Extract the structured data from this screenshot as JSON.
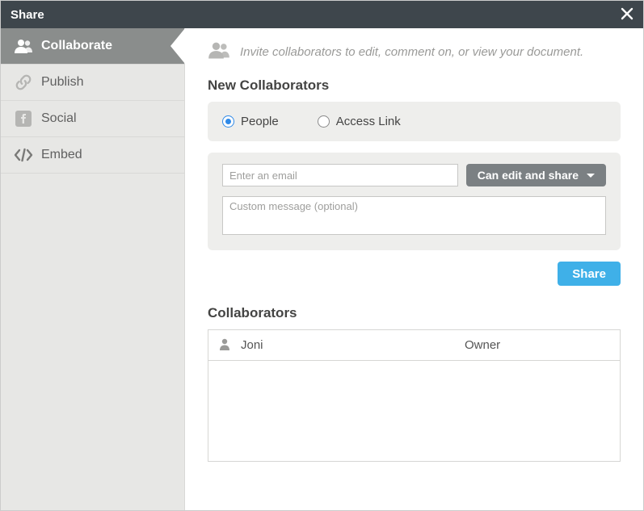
{
  "title": "Share",
  "sidebar": {
    "items": [
      {
        "label": "Collaborate"
      },
      {
        "label": "Publish"
      },
      {
        "label": "Social"
      },
      {
        "label": "Embed"
      }
    ]
  },
  "intro": "Invite collaborators to edit, comment on, or view your document.",
  "new_collaborators_heading": "New Collaborators",
  "radio": {
    "people": "People",
    "access_link": "Access Link"
  },
  "email_placeholder": "Enter an email",
  "permission_label": "Can edit and share",
  "message_placeholder": "Custom message (optional)",
  "share_button": "Share",
  "collaborators_heading": "Collaborators",
  "collaborators": [
    {
      "name": "Joni",
      "role": "Owner"
    }
  ]
}
